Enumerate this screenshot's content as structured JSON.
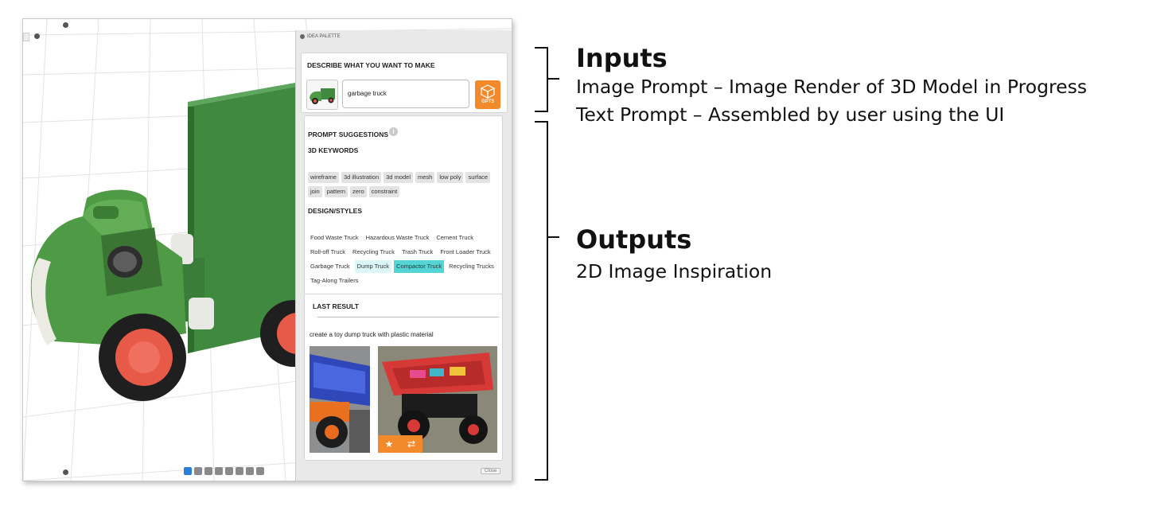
{
  "palette": {
    "window_title": "IDEA PALETTE",
    "describe": {
      "title": "DESCRIBE WHAT YOU WANT TO MAKE",
      "prompt_value": "garbage truck",
      "gpt3_label": "GPT3"
    },
    "suggestions": {
      "title": "PROMPT SUGGESTIONS",
      "keywords_title": "3D KEYWORDS",
      "keywords": [
        "wireframe",
        "3d illustration",
        "3d model",
        "mesh",
        "low poly",
        "surface",
        "join",
        "pattern",
        "zero",
        "constraint"
      ],
      "styles_title": "DESIGN/STYLES",
      "styles": [
        {
          "label": "Food Waste Truck",
          "state": "none"
        },
        {
          "label": "Hazardous Waste Truck",
          "state": "none"
        },
        {
          "label": "Cement Truck",
          "state": "none"
        },
        {
          "label": "Roll-off Truck",
          "state": "none"
        },
        {
          "label": "Recycling Truck",
          "state": "none"
        },
        {
          "label": "Trash Truck",
          "state": "none"
        },
        {
          "label": "Front Loader Truck",
          "state": "none"
        },
        {
          "label": "Garbage Truck",
          "state": "none"
        },
        {
          "label": "Dump Truck",
          "state": "light"
        },
        {
          "label": "Compactor Truck",
          "state": "strong"
        },
        {
          "label": "Recycling Trucks",
          "state": "none"
        },
        {
          "label": "Tag-Along Trailers",
          "state": "none"
        }
      ]
    },
    "result": {
      "title": "LAST RESULT",
      "prompt_text": "create a toy dump truck with plastic material"
    },
    "close_label": "Close"
  },
  "annotations": {
    "inputs_heading": "Inputs",
    "inputs_line1": "Image Prompt –  Image Render of 3D Model in Progress",
    "inputs_line2": "Text Prompt – Assembled by user using the UI",
    "outputs_heading": "Outputs",
    "outputs_line1": "2D Image Inspiration"
  },
  "colors": {
    "accent_orange": "#f28a2b",
    "selected_teal": "#54d5d5",
    "selected_teal_light": "#dcf7f7",
    "truck_green": "#3f8a3f",
    "wheel_red": "#e85a48"
  },
  "icons": [
    "info-icon",
    "cube-icon",
    "star-icon",
    "shuffle-icon"
  ]
}
